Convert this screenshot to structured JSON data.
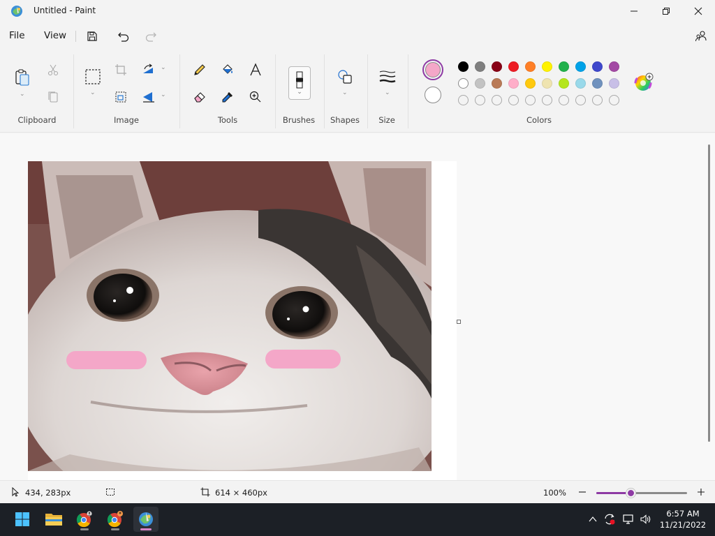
{
  "window": {
    "title": "Untitled - Paint"
  },
  "menu": {
    "file": "File",
    "view": "View"
  },
  "ribbon": {
    "groups": {
      "clipboard": "Clipboard",
      "image": "Image",
      "tools": "Tools",
      "brushes": "Brushes",
      "shapes": "Shapes",
      "size": "Size",
      "colors": "Colors"
    }
  },
  "colors": {
    "primary": "#f4a7c8",
    "secondary": "#ffffff",
    "palette_row1": [
      "#000000",
      "#7f7f7f",
      "#880015",
      "#ed1c24",
      "#ff7f27",
      "#fff200",
      "#22b14c",
      "#00a2e8",
      "#3f48cc",
      "#a349a4"
    ],
    "palette_row2": [
      "#ffffff",
      "#c3c3c3",
      "#b97a57",
      "#ffaec9",
      "#ffc90e",
      "#efe4b0",
      "#b5e61d",
      "#99d9ea",
      "#7092be",
      "#c8bfe7"
    ],
    "palette_row3_count": 10,
    "accent": "#8e3aa4"
  },
  "status": {
    "cursor_position": "434, 283px",
    "canvas_size": "614 × 460px",
    "zoom_level": "100%",
    "zoom_fraction": 0.38
  },
  "taskbar": {
    "time": "6:57 AM",
    "date": "11/21/2022"
  }
}
